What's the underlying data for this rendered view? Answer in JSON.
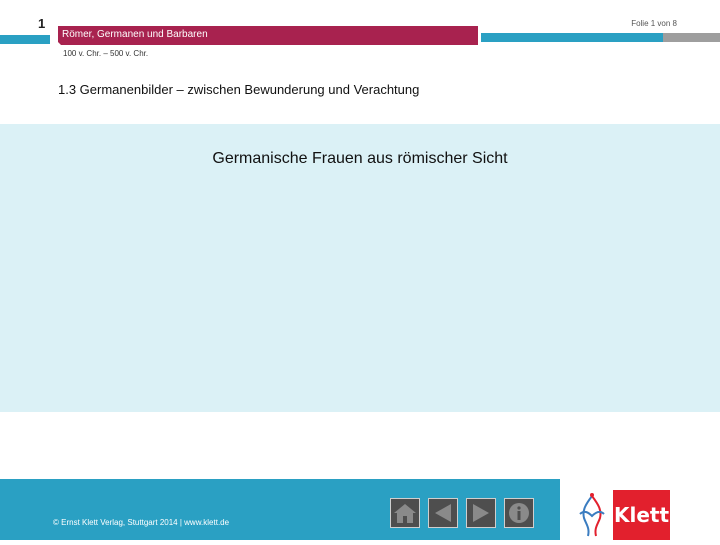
{
  "header": {
    "slide_number": "1",
    "slide_counter": "Folie 1 von 8",
    "chapter_title": "Römer, Germanen und Barbaren",
    "date_range": "100 v. Chr. – 500 v. Chr."
  },
  "section": {
    "title": "1.3  Germanenbilder – zwischen Bewunderung und Verachtung"
  },
  "content": {
    "title": "Germanische Frauen aus römischer Sicht"
  },
  "footer": {
    "copyright": "© Ernst Klett Verlag, Stuttgart 2014 | www.klett.de",
    "buttons": [
      {
        "icon": "home-icon"
      },
      {
        "icon": "back-arrow-icon"
      },
      {
        "icon": "forward-arrow-icon"
      },
      {
        "icon": "info-icon"
      }
    ]
  },
  "logo": {
    "text": "Klett",
    "brand_color": "#e2202d"
  },
  "colors": {
    "accent_blue": "#2aa0c3",
    "header_red": "#a8224f",
    "panel_bg": "#dbf1f6"
  }
}
